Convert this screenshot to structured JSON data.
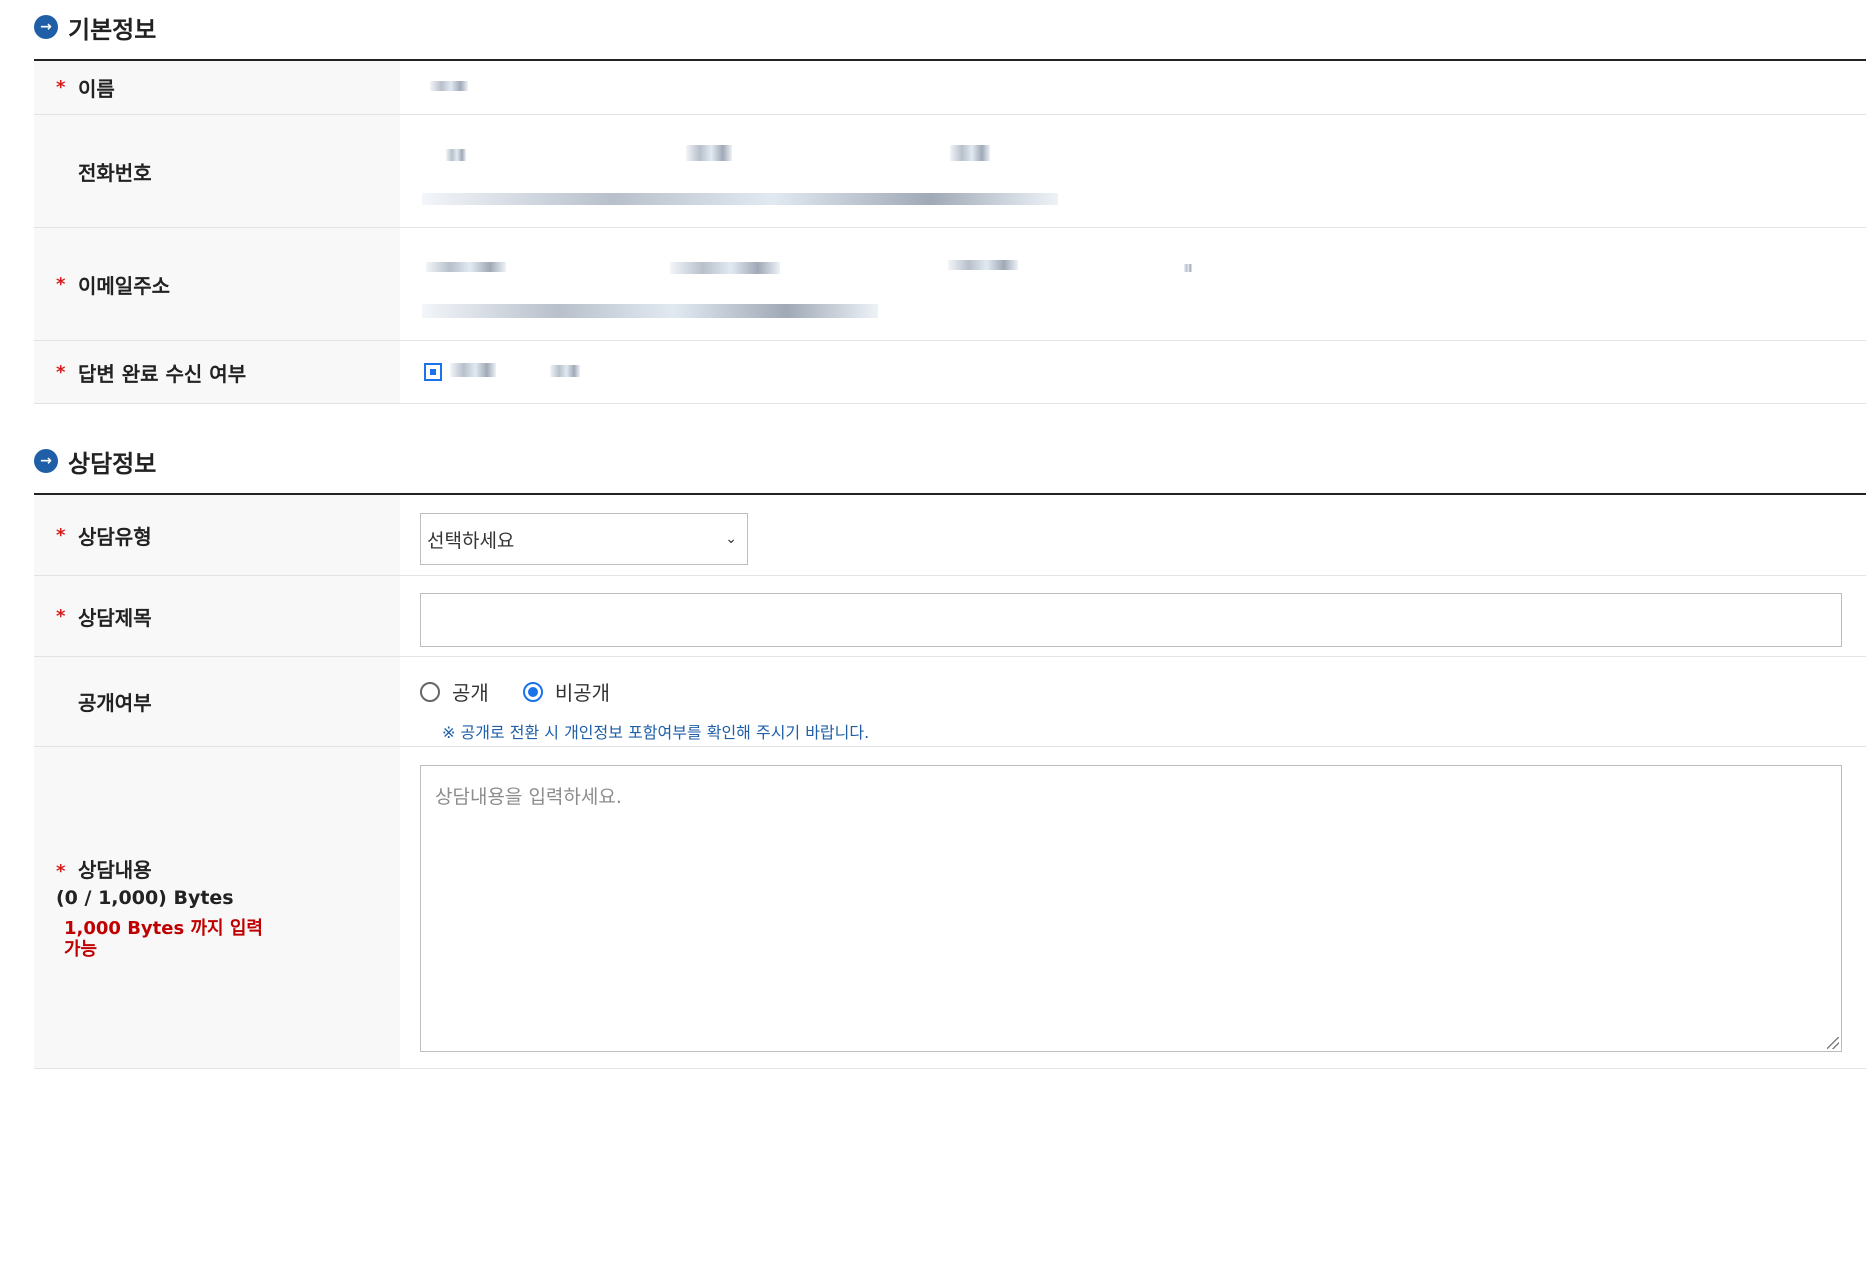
{
  "basic_info": {
    "title": "기본정보",
    "fields": {
      "name_label": "이름",
      "phone_label": "전화번호",
      "email_label": "이메일주소",
      "reply_notify_label": "답변 완료 수신 여부"
    }
  },
  "consult_info": {
    "title": "상담정보",
    "type_label": "상담유형",
    "type_selected": "선택하세요",
    "subject_label": "상담제목",
    "subject_value": "",
    "public_label": "공개여부",
    "public_options": [
      "공개",
      "비공개"
    ],
    "public_selected": "비공개",
    "public_notice": "※ 공개로 전환 시 개인정보 포함여부를 확인해 주시기 바랍니다.",
    "content_label": "상담내용",
    "content_bytes": "(0 / 1,000) Bytes",
    "content_limit": "1,000 Bytes 까지 입력 가능",
    "content_placeholder": "상담내용을 입력하세요."
  },
  "required_mark": "*",
  "colors": {
    "accent": "#1f5fa8",
    "required": "#d71c1c",
    "limit_text": "#c00000",
    "radio_selected": "#1a73e8"
  }
}
